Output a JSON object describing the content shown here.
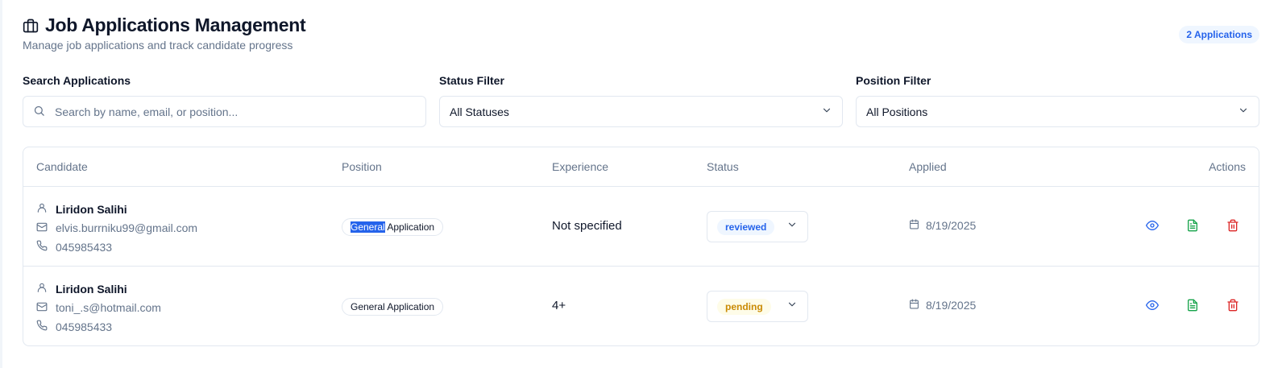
{
  "header": {
    "title": "Job Applications Management",
    "subtitle": "Manage job applications and track candidate progress",
    "count_badge": "2 Applications",
    "icon": "briefcase-icon"
  },
  "filters": {
    "search": {
      "label": "Search Applications",
      "placeholder": "Search by name, email, or position..."
    },
    "status": {
      "label": "Status Filter",
      "value": "All Statuses"
    },
    "position": {
      "label": "Position Filter",
      "value": "All Positions"
    }
  },
  "table": {
    "columns": [
      "Candidate",
      "Position",
      "Experience",
      "Status",
      "Applied",
      "Actions"
    ],
    "rows": [
      {
        "name": "Liridon Salihi",
        "email": "elvis.burrniku99@gmail.com",
        "phone": "045985433",
        "position_highlight": "General",
        "position_rest": " Application",
        "experience": "Not specified",
        "status": "reviewed",
        "applied": "8/19/2025"
      },
      {
        "name": "Liridon Salihi",
        "email": "toni_.s@hotmail.com",
        "phone": "045985433",
        "position": "General Application",
        "experience": "4+",
        "status": "pending",
        "applied": "8/19/2025"
      }
    ]
  },
  "colors": {
    "accent_blue": "#2563eb",
    "view_icon": "#2563eb",
    "document_icon": "#16a34a",
    "delete_icon": "#dc2626",
    "reviewed_bg": "#eff6ff",
    "pending_bg": "#fefce8",
    "pending_text": "#ca8a04"
  }
}
